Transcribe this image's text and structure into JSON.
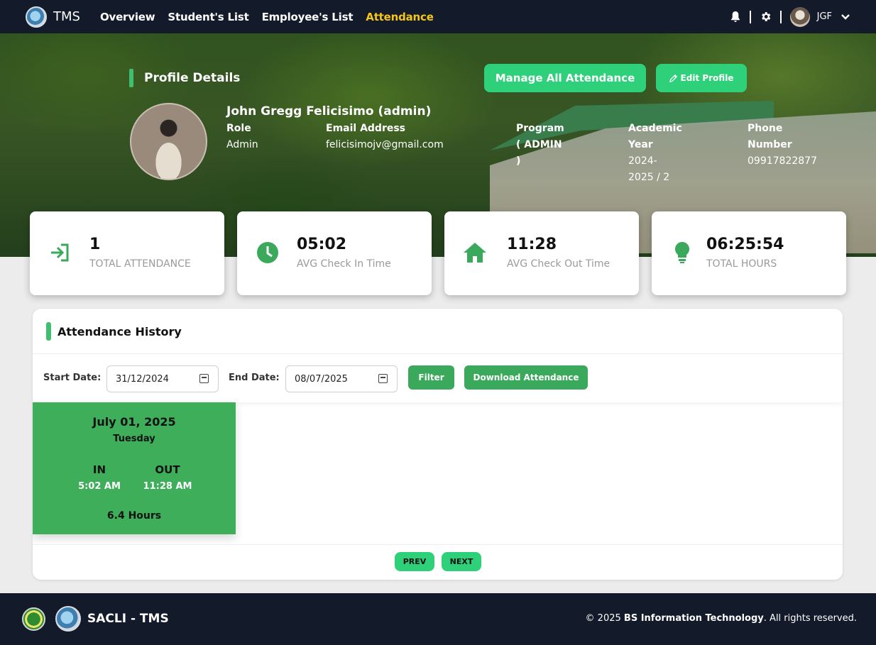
{
  "nav": {
    "brand": "TMS",
    "links": [
      "Overview",
      "Student's List",
      "Employee's List",
      "Attendance"
    ],
    "active": "Attendance",
    "user_initials": "JGF"
  },
  "profile": {
    "section_title": "Profile Details",
    "manage_button": "Manage All Attendance",
    "edit_button": "Edit Profile",
    "name": "John Gregg Felicisimo (admin)",
    "fields": {
      "role_label": "Role",
      "role_value": "Admin",
      "email_label": "Email Address",
      "email_value": "felicisimojv@gmail.com",
      "program_label": "Program",
      "program_value_1": "( ADMIN",
      "program_value_2": ")",
      "year_label_1": "Academic",
      "year_label_2": "Year",
      "year_value_1": "2024-",
      "year_value_2": "2025 / 2",
      "phone_label_1": "Phone",
      "phone_label_2": "Number",
      "phone_value": "09917822877"
    }
  },
  "stats": [
    {
      "value": "1",
      "label": "TOTAL ATTENDANCE",
      "icon": "login-arrow-icon"
    },
    {
      "value": "05:02",
      "label": "AVG Check In Time",
      "icon": "clock-icon"
    },
    {
      "value": "11:28",
      "label": "AVG Check Out Time",
      "icon": "home-icon"
    },
    {
      "value": "06:25:54",
      "label": "TOTAL HOURS",
      "icon": "lightbulb-icon"
    }
  ],
  "attendance": {
    "title": "Attendance History",
    "start_label": "Start Date:",
    "start_value": "31/12/2024",
    "end_label": "End Date:",
    "end_value": "08/07/2025",
    "filter_button": "Filter",
    "download_button": "Download Attendance",
    "records": [
      {
        "date": "July 01, 2025",
        "day": "Tuesday",
        "in_label": "IN",
        "out_label": "OUT",
        "in_time": "5:02 AM",
        "out_time": "11:28 AM",
        "hours": "6.4 Hours"
      }
    ],
    "prev": "PREV",
    "next": "NEXT"
  },
  "footer": {
    "brand": "SACLI - TMS",
    "copy_prefix": "© 2025",
    "copy_bold": "BS Information Technology",
    "copy_suffix": ". All rights reserved."
  },
  "colors": {
    "accent": "#2ed07a",
    "nav_bg": "#131a2a",
    "active_link": "#f5c518",
    "card_green": "#3fae5a"
  }
}
